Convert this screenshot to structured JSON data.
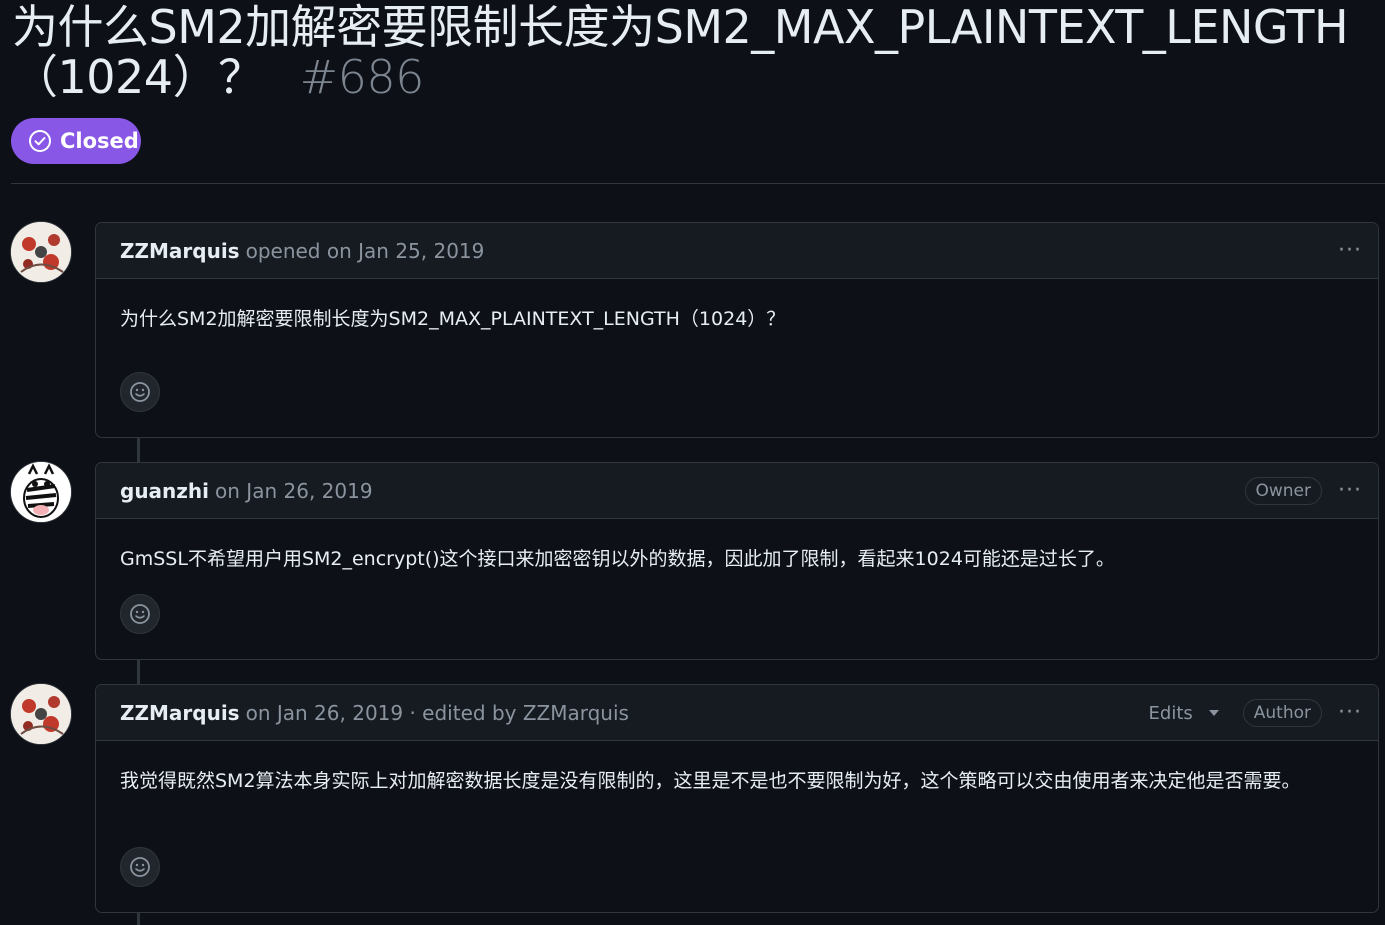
{
  "issue": {
    "title": "为什么SM2加解密要限制长度为SM2_MAX_PLAINTEXT_LENGTH（1024）？",
    "number": "#686",
    "status": "Closed"
  },
  "comments": [
    {
      "author": "ZZMarquis",
      "meta": "opened on Jan 25, 2019",
      "body": "为什么SM2加解密要限制长度为SM2_MAX_PLAINTEXT_LENGTH（1024）？",
      "menu": "···"
    },
    {
      "author": "guanzhi",
      "meta": "on Jan 26, 2019",
      "role": "Owner",
      "body": "GmSSL不希望用户用SM2_encrypt()这个接口来加密密钥以外的数据，因此加了限制，看起来1024可能还是过长了。",
      "menu": "···"
    },
    {
      "author": "ZZMarquis",
      "meta": "on Jan 26, 2019 · edited by ZZMarquis",
      "edits": "Edits",
      "role": "Author",
      "body": "我觉得既然SM2算法本身实际上对加解密数据长度是没有限制的，这里是不是也不要限制为好，这个策略可以交由使用者来决定他是否需要。",
      "menu": "···"
    }
  ],
  "colors": {
    "closed": "#8957e5",
    "bg": "#0d1117",
    "border": "#30363d"
  },
  "icons": [
    "closed-check-icon",
    "smiley-icon",
    "kebab-icon",
    "caret-down-icon"
  ]
}
